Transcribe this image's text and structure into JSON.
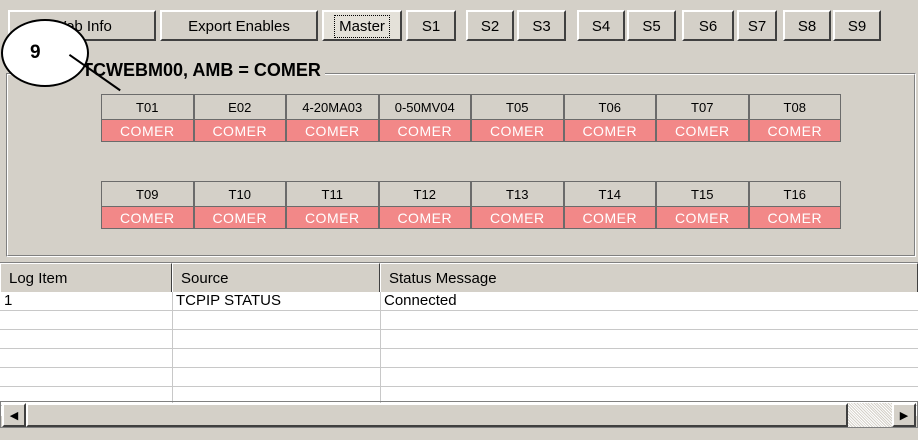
{
  "tabs": [
    {
      "label": "Web Info",
      "active": false
    },
    {
      "label": "Export Enables",
      "active": false
    },
    {
      "label": "Master",
      "active": true
    },
    {
      "label": "S1",
      "active": false
    },
    {
      "label": "S2",
      "active": false
    },
    {
      "label": "S3",
      "active": false
    },
    {
      "label": "S4",
      "active": false
    },
    {
      "label": "S5",
      "active": false
    },
    {
      "label": "S6",
      "active": false
    },
    {
      "label": "S7",
      "active": false
    },
    {
      "label": "S8",
      "active": false
    },
    {
      "label": "S9",
      "active": false
    }
  ],
  "callout": {
    "number": "9"
  },
  "panel": {
    "title": "TCWEBM00, AMB = COMER",
    "row1": [
      {
        "name": "T01",
        "status": "COMER"
      },
      {
        "name": "E02",
        "status": "COMER"
      },
      {
        "name": "4-20MA03",
        "status": "COMER"
      },
      {
        "name": "0-50MV04",
        "status": "COMER"
      },
      {
        "name": "T05",
        "status": "COMER"
      },
      {
        "name": "T06",
        "status": "COMER"
      },
      {
        "name": "T07",
        "status": "COMER"
      },
      {
        "name": "T08",
        "status": "COMER"
      }
    ],
    "row2": [
      {
        "name": "T09",
        "status": "COMER"
      },
      {
        "name": "T10",
        "status": "COMER"
      },
      {
        "name": "T11",
        "status": "COMER"
      },
      {
        "name": "T12",
        "status": "COMER"
      },
      {
        "name": "T13",
        "status": "COMER"
      },
      {
        "name": "T14",
        "status": "COMER"
      },
      {
        "name": "T15",
        "status": "COMER"
      },
      {
        "name": "T16",
        "status": "COMER"
      }
    ]
  },
  "log": {
    "columns": [
      "Log Item",
      "Source",
      "Status Message"
    ],
    "rows": [
      [
        "1",
        "TCPIP STATUS",
        "Connected"
      ],
      [
        "",
        "",
        ""
      ],
      [
        "",
        "",
        ""
      ],
      [
        "",
        "",
        ""
      ],
      [
        "",
        "",
        ""
      ],
      [
        "",
        "",
        ""
      ]
    ]
  },
  "colors": {
    "status_bg": "#f28888",
    "status_text": "#ffffff",
    "face": "#d4d0c8"
  },
  "icons": {
    "scroll_left": "arrow-left-icon",
    "scroll_right": "arrow-right-icon"
  }
}
